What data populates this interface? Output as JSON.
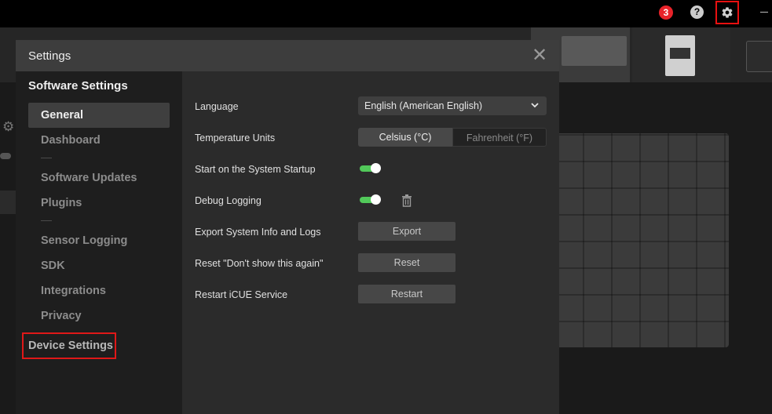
{
  "topbar": {
    "notification_count": "3",
    "help_symbol": "?",
    "icons": [
      "notification-badge",
      "help-icon",
      "gear-icon",
      "minimize-icon"
    ]
  },
  "dialog": {
    "title": "Settings",
    "close_symbol": "✕"
  },
  "sidebar": {
    "section_title": "Software Settings",
    "items": [
      {
        "label": "General",
        "active": true
      },
      {
        "label": "Dashboard"
      },
      {
        "label": "Software Updates"
      },
      {
        "label": "Plugins"
      },
      {
        "label": "Sensor Logging"
      },
      {
        "label": "SDK"
      },
      {
        "label": "Integrations"
      },
      {
        "label": "Privacy"
      }
    ],
    "device_settings": "Device Settings"
  },
  "settings": {
    "language": {
      "label": "Language",
      "value": "English (American English)"
    },
    "temperature": {
      "label": "Temperature Units",
      "option_celsius": "Celsius (°C)",
      "option_fahrenheit": "Fahrenheit (°F)",
      "selected": "Celsius (°C)"
    },
    "startup": {
      "label": "Start on the System Startup",
      "enabled": true
    },
    "debug": {
      "label": "Debug Logging",
      "enabled": true
    },
    "export": {
      "label": "Export System Info and Logs",
      "button": "Export"
    },
    "reset": {
      "label": "Reset \"Don't show this again\"",
      "button": "Reset"
    },
    "restart": {
      "label": "Restart iCUE Service",
      "button": "Restart"
    }
  },
  "colors": {
    "accent_red": "#e8232a",
    "toggle_on": "#52c95a",
    "highlight_box": "#e01818"
  }
}
